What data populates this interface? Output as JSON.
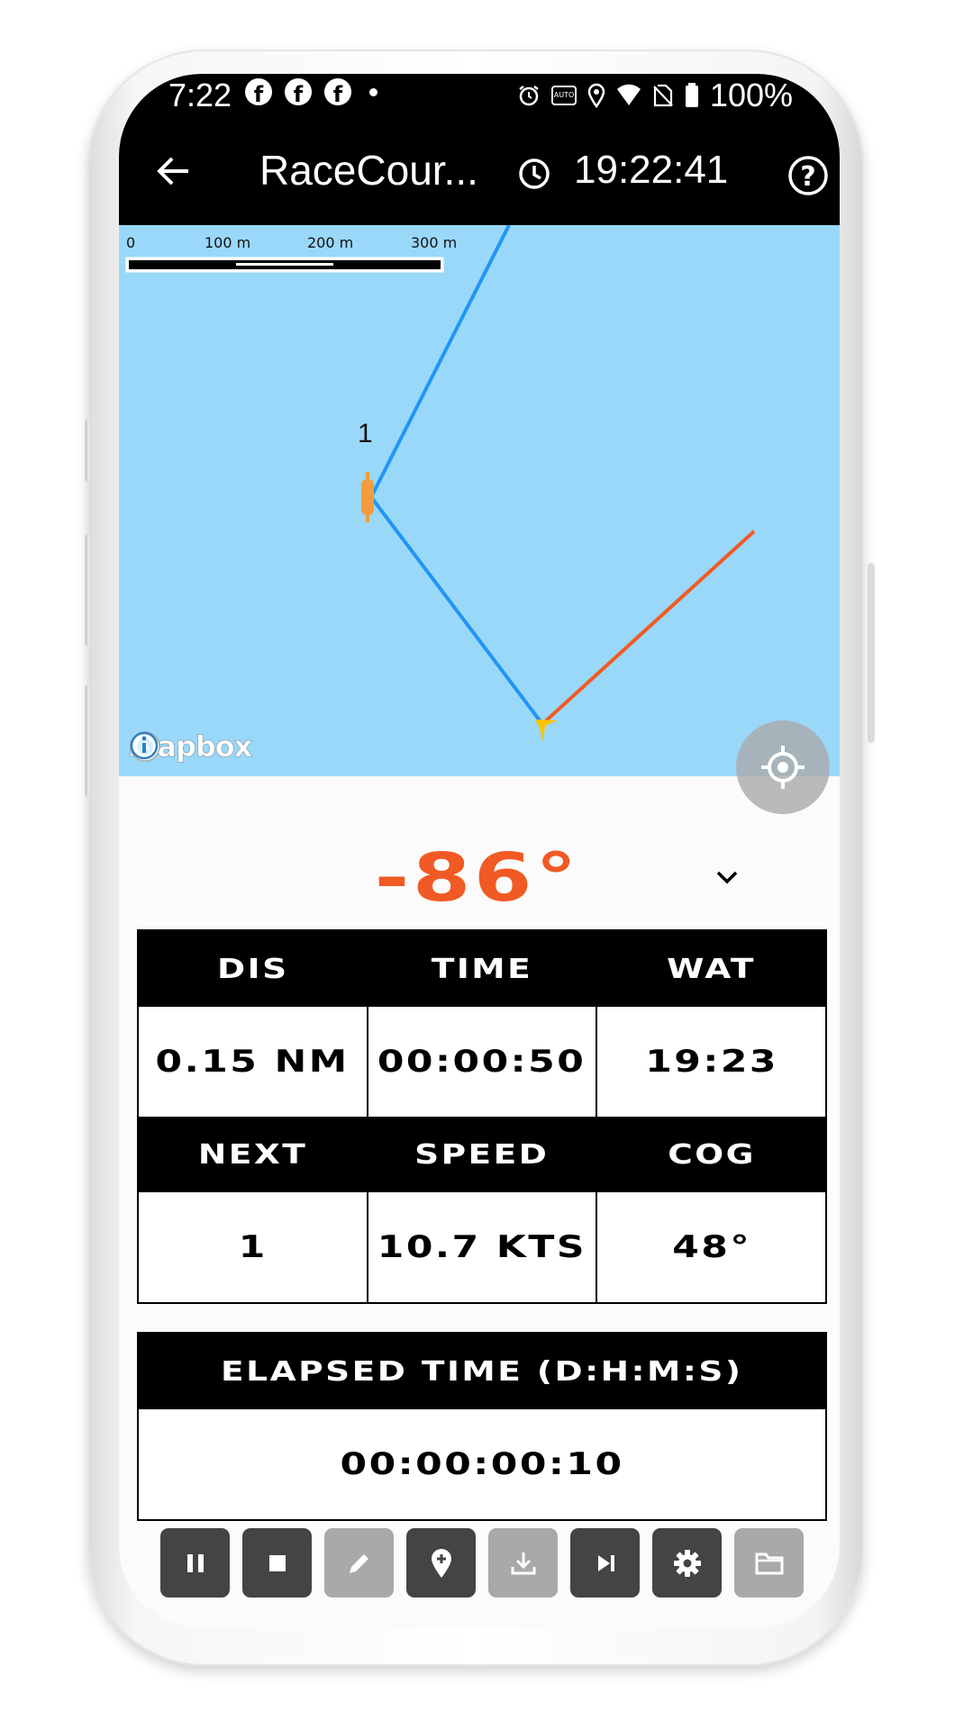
{
  "status_bar": {
    "time": "7:22",
    "battery": "100%",
    "left_icons": [
      "facebook-icon",
      "facebook-icon",
      "facebook-icon",
      "dot-icon"
    ],
    "right_icons": [
      "alarm-icon",
      "auto-brightness-icon",
      "location-icon",
      "wifi-icon",
      "no-sim-icon",
      "battery-icon"
    ]
  },
  "app_bar": {
    "title": "RaceCour...",
    "clock": "19:22:41",
    "icons": [
      "back-arrow-icon",
      "clock-icon",
      "help-icon"
    ]
  },
  "map": {
    "scale_labels": [
      "0",
      "100 m",
      "200 m",
      "300 m"
    ],
    "mark_label": "1",
    "attribution": "mapbox",
    "colors": {
      "water": "#9ad8fa",
      "course_line": "#2196f3",
      "track_line": "#f15a24",
      "mark": "#f39c3c",
      "boat": "#ffc400"
    }
  },
  "heading": {
    "value": "-86°",
    "color": "#f15a24"
  },
  "stats": {
    "headers_1": [
      "DIS",
      "TIME",
      "WAT"
    ],
    "values_1": [
      "0.15 NM",
      "00:00:50",
      "19:23"
    ],
    "headers_2": [
      "NEXT",
      "SPEED",
      "COG"
    ],
    "values_2": [
      "1",
      "10.7 KTS",
      "48°"
    ]
  },
  "elapsed": {
    "header": "ELAPSED TIME (D:H:M:S)",
    "value": "00:00:00:10"
  },
  "toolbar": [
    {
      "name": "pause-button",
      "icon": "pause-icon",
      "enabled": true
    },
    {
      "name": "stop-button",
      "icon": "stop-icon",
      "enabled": true
    },
    {
      "name": "edit-button",
      "icon": "pencil-icon",
      "enabled": false
    },
    {
      "name": "add-mark-button",
      "icon": "add-location-icon",
      "enabled": true
    },
    {
      "name": "download-button",
      "icon": "download-icon",
      "enabled": false
    },
    {
      "name": "skip-next-button",
      "icon": "skip-next-icon",
      "enabled": true
    },
    {
      "name": "settings-button",
      "icon": "gear-icon",
      "enabled": true
    },
    {
      "name": "folder-button",
      "icon": "folder-icon",
      "enabled": false
    }
  ]
}
